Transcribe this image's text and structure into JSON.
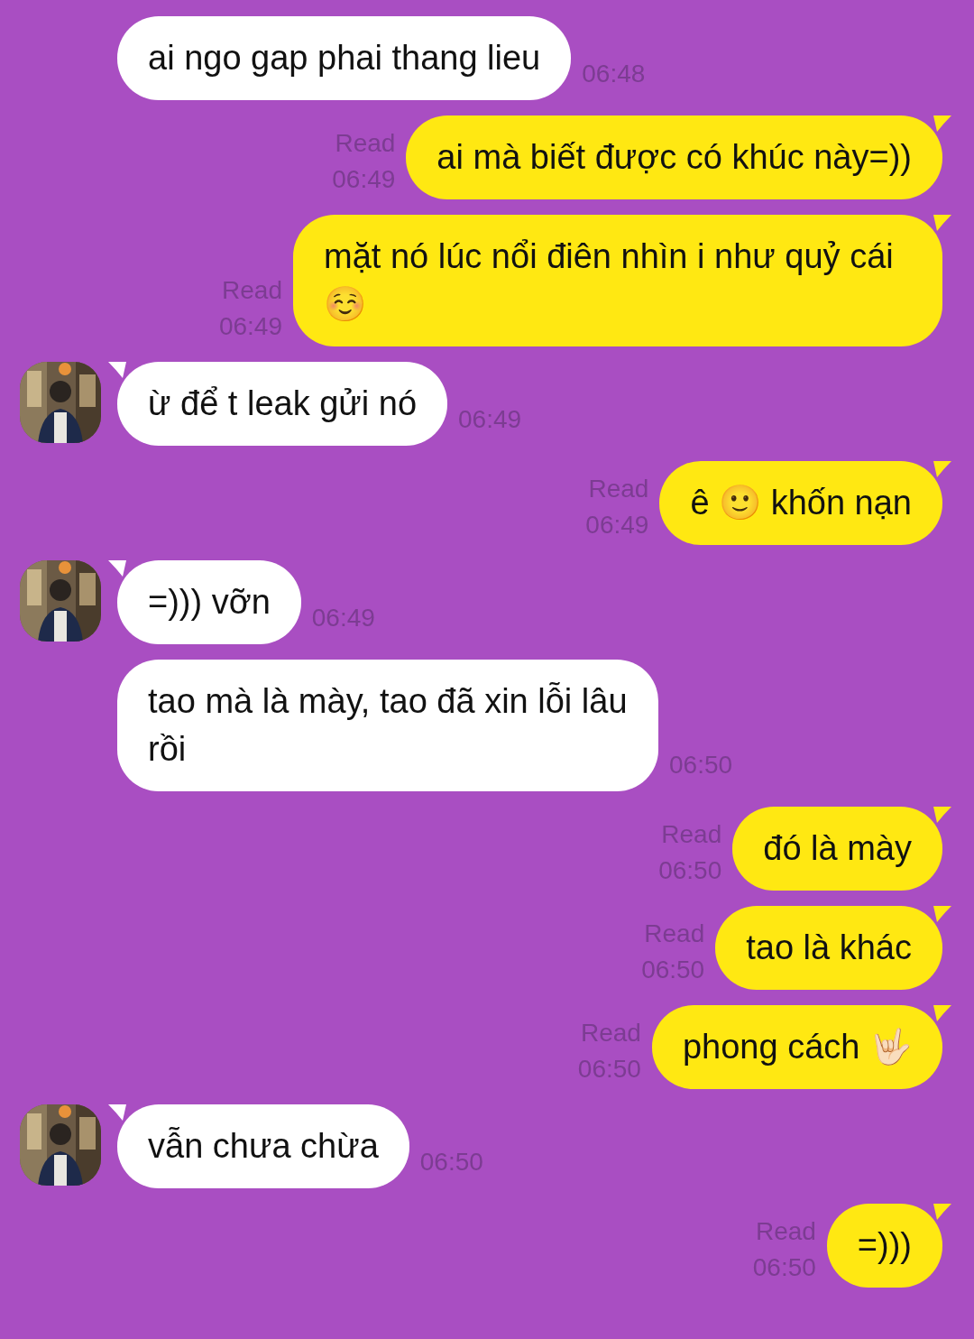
{
  "messages": [
    {
      "kind": "in",
      "avatar": false,
      "text": "ai ngo gap phai thang lieu",
      "time": "06:48"
    },
    {
      "kind": "out",
      "read": "Read",
      "text": "ai mà biết được có khúc này=))",
      "time": "06:49"
    },
    {
      "kind": "out",
      "read": "Read",
      "text": "mặt nó lúc nổi điên nhìn i như quỷ cái ☺️",
      "time": "06:49"
    },
    {
      "kind": "in",
      "avatar": true,
      "text": "ừ để t leak gửi nó",
      "time": "06:49"
    },
    {
      "kind": "out",
      "read": "Read",
      "text": "ê 🙂 khốn nạn",
      "time": "06:49"
    },
    {
      "kind": "in",
      "avatar": true,
      "text": "=))) vỡn",
      "time": "06:49"
    },
    {
      "kind": "in",
      "avatar": false,
      "text": "tao mà là mày, tao đã xin lỗi lâu rồi",
      "time": "06:50"
    },
    {
      "kind": "out",
      "read": "Read",
      "text": "đó là mày",
      "time": "06:50"
    },
    {
      "kind": "out",
      "read": "Read",
      "text": "tao là khác",
      "time": "06:50"
    },
    {
      "kind": "out",
      "read": "Read",
      "text": "phong cách 🤟🏻",
      "time": "06:50"
    },
    {
      "kind": "in",
      "avatar": true,
      "text": "vẫn chưa chừa",
      "time": "06:50"
    },
    {
      "kind": "out",
      "read": "Read",
      "text": "=)))",
      "time": "06:50"
    }
  ]
}
